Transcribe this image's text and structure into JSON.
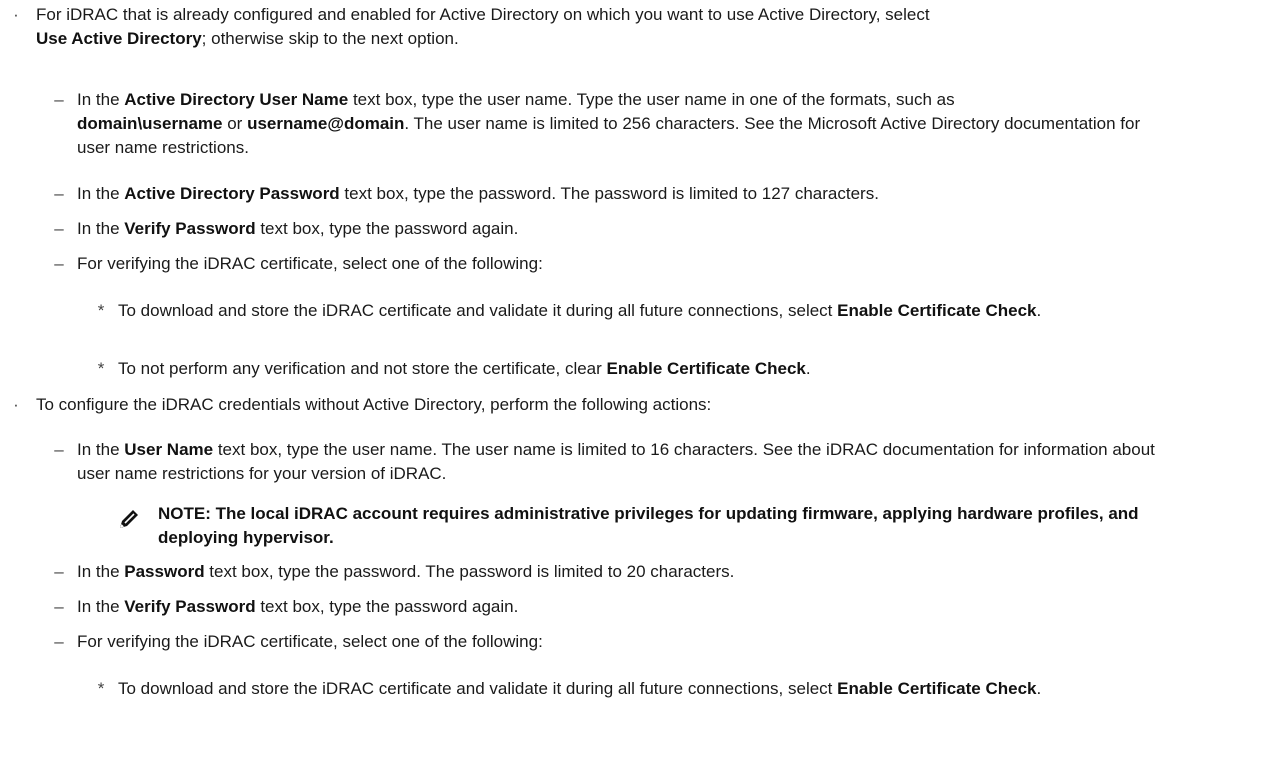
{
  "bullets": {
    "bullet_mark": "·",
    "dash_mark": "–",
    "star_mark": "*"
  },
  "s1": {
    "pre": "For iDRAC that is already configured and enabled for Active Directory on which you want to use Active Directory, select",
    "bold": "Use Active Directory",
    "post": "; otherwise skip to the next option."
  },
  "s1a": {
    "pre": "In the ",
    "bold1": "Active Directory User Name",
    "mid1": " text box, type the user name. Type the user name in one of the formats, such as",
    "bold2": "domain\\username",
    "mid2": " or ",
    "bold3": "username@domain",
    "post": ". The user name is limited to 256 characters. See the Microsoft Active Directory documentation for user name restrictions."
  },
  "s1b": {
    "pre": "In the ",
    "bold": "Active Directory Password",
    "post": " text box, type the password. The password is limited to 127 characters."
  },
  "s1c": {
    "pre": "In the ",
    "bold": "Verify Password",
    "post": " text box, type the password again."
  },
  "s1d": {
    "text": "For verifying the iDRAC certificate, select one of the following:"
  },
  "s1d1": {
    "pre": "To download and store the iDRAC certificate and validate it during all future connections, select ",
    "bold": "Enable Certificate Check",
    "post": "."
  },
  "s1d2": {
    "pre": "To not perform any verification and not store the certificate, clear ",
    "bold": "Enable Certificate Check",
    "post": "."
  },
  "s2": {
    "text": "To configure the iDRAC credentials without Active Directory, perform the following actions:"
  },
  "s2a": {
    "pre": "In the ",
    "bold": "User Name",
    "post": " text box, type the user name. The user name is limited to 16 characters. See the iDRAC documentation for information about user name restrictions for your version of iDRAC."
  },
  "note": {
    "text": "NOTE: The local iDRAC account requires administrative privileges for updating firmware, applying hardware profiles, and deploying hypervisor."
  },
  "s2b": {
    "pre": "In the ",
    "bold": "Password",
    "post": " text box, type the password. The password is limited to 20 characters."
  },
  "s2c": {
    "pre": "In the ",
    "bold": "Verify Password",
    "post": " text box, type the password again."
  },
  "s2d": {
    "text": "For verifying the iDRAC certificate, select one of the following:"
  },
  "s2d1": {
    "pre": "To download and store the iDRAC certificate and validate it during all future connections, select ",
    "bold": "Enable Certificate Check",
    "post": "."
  }
}
